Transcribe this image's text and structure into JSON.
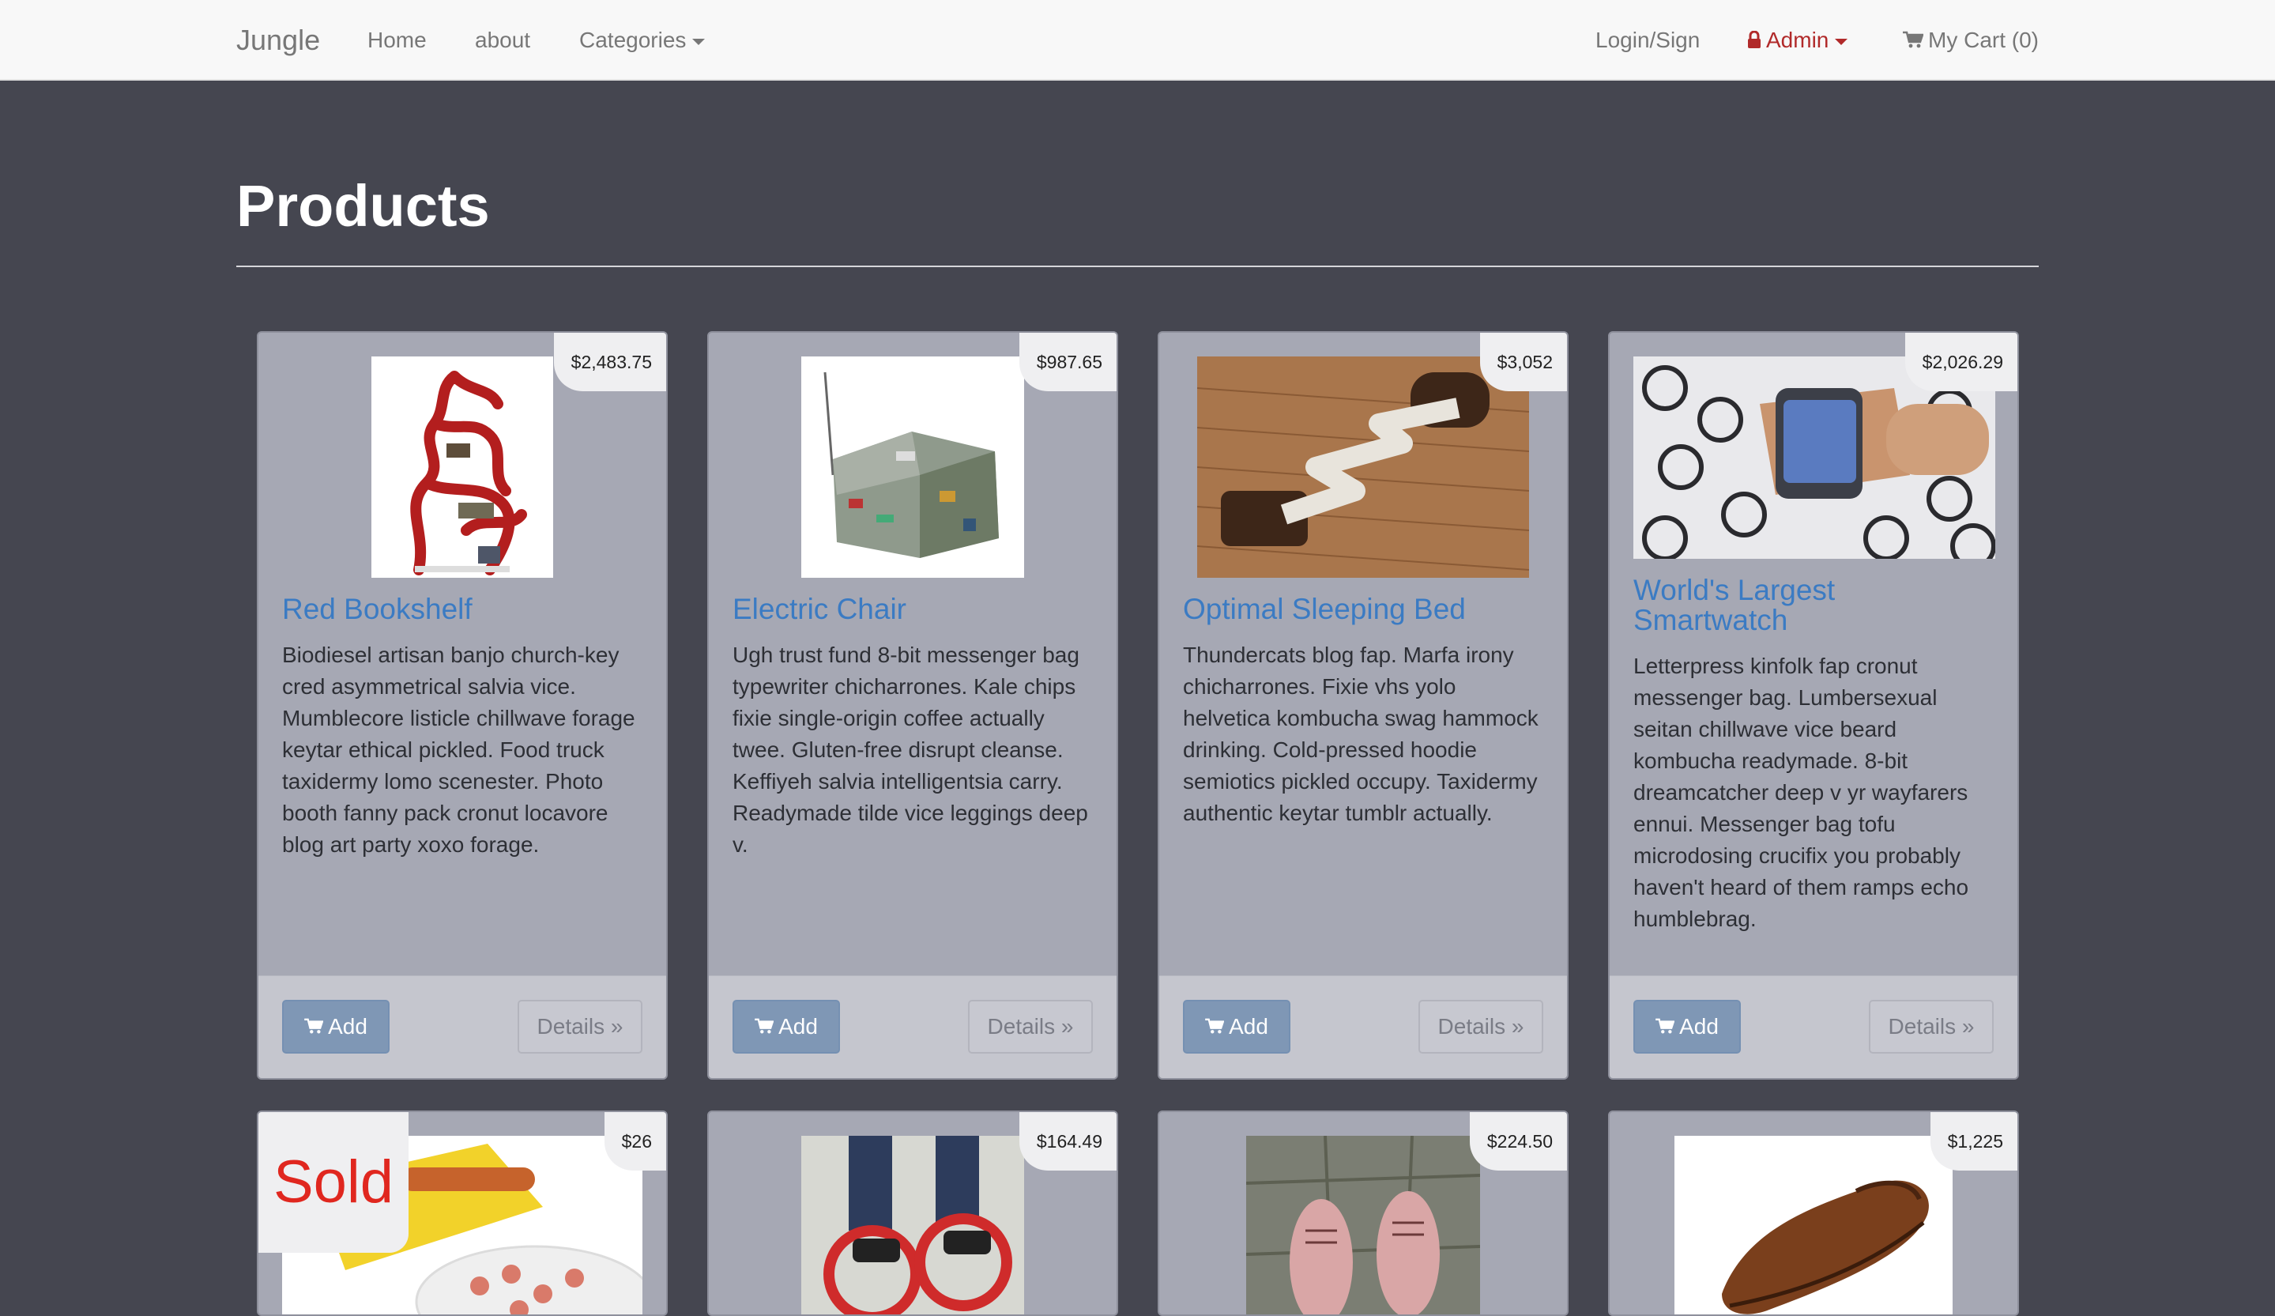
{
  "navbar": {
    "brand": "Jungle",
    "links": [
      "Home",
      "about",
      "Categories"
    ],
    "login_label": "Login/Sign",
    "admin_label": "Admin",
    "cart_label": "My Cart (0)",
    "icons": {
      "categories": "chevron-down-icon",
      "admin": "lock-icon",
      "cart": "shopping-cart-icon"
    }
  },
  "page": {
    "title": "Products"
  },
  "colors": {
    "page_bg": "#454650",
    "card_bg": "#a6a8b4",
    "link_blue": "#3b7bc3",
    "admin_red": "#b12a2a",
    "add_button": "#7f97b5",
    "sold_red": "#e0271f"
  },
  "buttons": {
    "add_label": "Add",
    "details_label": "Details »",
    "add_icon": "shopping-cart-icon"
  },
  "products": [
    {
      "name": "Red Bookshelf",
      "price": "$2,483.75",
      "description": "Biodiesel artisan banjo church-key cred asymmetrical salvia vice. Mumblecore listicle chillwave forage keytar ethical pickled. Food truck taxidermy lomo scenester. Photo booth fanny pack cronut locavore blog art party xoxo forage.",
      "image": "red bookshelf photo"
    },
    {
      "name": "Electric Chair",
      "price": "$987.65",
      "description": "Ugh trust fund 8-bit messenger bag typewriter chicharrones. Kale chips fixie single-origin coffee actually twee. Gluten-free disrupt cleanse. Keffiyeh salvia intelligentsia carry. Readymade tilde vice leggings deep v.",
      "image": "circuit board armchair photo"
    },
    {
      "name": "Optimal Sleeping Bed",
      "price": "$3,052",
      "description": "Thundercats blog fap. Marfa irony chicharrones. Fixie vhs yolo helvetica kombucha swag hammock drinking. Cold-pressed hoodie semiotics pickled occupy. Taxidermy authentic keytar tumblr actually.",
      "image": "zigzag bed photo"
    },
    {
      "name": "World's Largest Smartwatch",
      "price": "$2,026.29",
      "description": "Letterpress kinfolk fap cronut messenger bag. Lumbersexual seitan chillwave vice beard kombucha readymade. 8-bit dreamcatcher deep v yr wayfarers ennui. Messenger bag tofu microdosing crucifix you probably haven't heard of them ramps echo humblebrag.",
      "image": "wrist smartwatch photo"
    },
    {
      "price": "$26",
      "sold_label": "Sold",
      "image": "hot dog slicer photo"
    },
    {
      "price": "$164.49",
      "image": "skate wheels photo"
    },
    {
      "price": "$224.50",
      "image": "pink shoes photo"
    },
    {
      "price": "$1,225",
      "image": "brown leather shoe photo"
    }
  ]
}
